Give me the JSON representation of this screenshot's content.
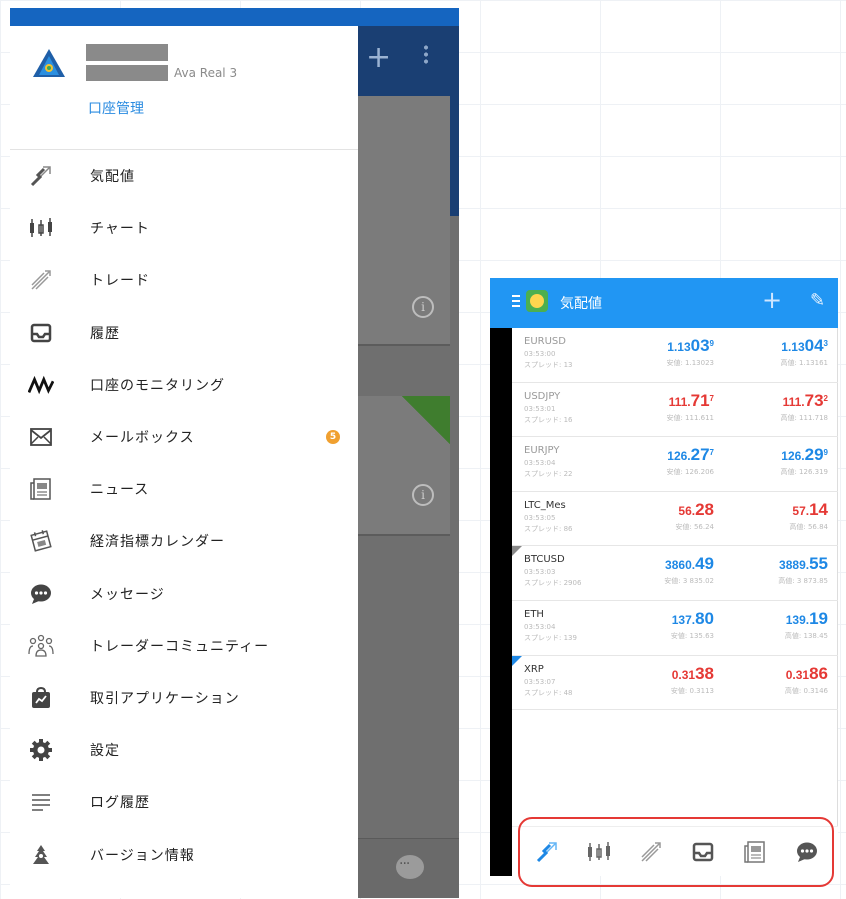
{
  "drawer": {
    "account_name": "Ava Real 3",
    "account_management": "口座管理",
    "items": [
      {
        "label": "気配値",
        "icon": "quotes-icon"
      },
      {
        "label": "チャート",
        "icon": "chart-icon"
      },
      {
        "label": "トレード",
        "icon": "trade-icon"
      },
      {
        "label": "履歴",
        "icon": "history-icon"
      },
      {
        "label": "口座のモニタリング",
        "icon": "monitoring-icon"
      },
      {
        "label": "メールボックス",
        "icon": "mailbox-icon",
        "badge": "5"
      },
      {
        "label": "ニュース",
        "icon": "news-icon"
      },
      {
        "label": "経済指標カレンダー",
        "icon": "calendar-icon"
      },
      {
        "label": "メッセージ",
        "icon": "message-icon"
      },
      {
        "label": "トレーダーコミュニティー",
        "icon": "community-icon"
      },
      {
        "label": "取引アプリケーション",
        "icon": "trading-apps-icon"
      },
      {
        "label": "設定",
        "icon": "settings-icon"
      },
      {
        "label": "ログ履歴",
        "icon": "log-icon"
      },
      {
        "label": "バージョン情報",
        "icon": "about-icon"
      }
    ]
  },
  "quotes_screen": {
    "title": "気配値",
    "rows": [
      {
        "symbol": "EURUSD",
        "time": "03:53:00",
        "spread": "スプレッド: 13",
        "bid_main": "1.13",
        "bid_big": "03",
        "bid_sup": "9",
        "bid_color": "blue",
        "ask_main": "1.13",
        "ask_big": "04",
        "ask_sup": "3",
        "ask_color": "blue",
        "low": "安値: 1.13023",
        "high": "高値: 1.13161"
      },
      {
        "symbol": "USDJPY",
        "time": "03:53:01",
        "spread": "スプレッド: 16",
        "bid_main": "111.",
        "bid_big": "71",
        "bid_sup": "7",
        "bid_color": "red",
        "ask_main": "111.",
        "ask_big": "73",
        "ask_sup": "2",
        "ask_color": "red",
        "low": "安値: 111.611",
        "high": "高値: 111.718"
      },
      {
        "symbol": "EURJPY",
        "time": "03:53:04",
        "spread": "スプレッド: 22",
        "bid_main": "126.",
        "bid_big": "27",
        "bid_sup": "7",
        "bid_color": "blue",
        "ask_main": "126.",
        "ask_big": "29",
        "ask_sup": "9",
        "ask_color": "blue",
        "low": "安値: 126.206",
        "high": "高値: 126.319"
      },
      {
        "symbol": "LTC_Mes",
        "time": "03:53:05",
        "spread": "スプレッド: 86",
        "bid_main": "56.",
        "bid_big": "28",
        "bid_sup": "",
        "bid_color": "red",
        "ask_main": "57.",
        "ask_big": "14",
        "ask_sup": "",
        "ask_color": "red",
        "low": "安値: 56.24",
        "high": "高値: 56.84"
      },
      {
        "symbol": "BTCUSD",
        "time": "03:53:03",
        "spread": "スプレッド: 2906",
        "bid_main": "3860.",
        "bid_big": "49",
        "bid_sup": "",
        "bid_color": "blue",
        "ask_main": "3889.",
        "ask_big": "55",
        "ask_sup": "",
        "ask_color": "blue",
        "low": "安値: 3 835.02",
        "high": "高値: 3 873.85"
      },
      {
        "symbol": "ETH",
        "time": "03:53:04",
        "spread": "スプレッド: 139",
        "bid_main": "137.",
        "bid_big": "80",
        "bid_sup": "",
        "bid_color": "blue",
        "ask_main": "139.",
        "ask_big": "19",
        "ask_sup": "",
        "ask_color": "blue",
        "low": "安値: 135.63",
        "high": "高値: 138.45"
      },
      {
        "symbol": "XRP",
        "time": "03:53:07",
        "spread": "スプレッド: 48",
        "bid_main": "0.31",
        "bid_big": "38",
        "bid_sup": "",
        "bid_color": "red",
        "ask_main": "0.31",
        "ask_big": "86",
        "ask_sup": "",
        "ask_color": "red",
        "low": "安値: 0.3113",
        "high": "高値: 0.3146"
      }
    ],
    "bottom_nav": [
      "quotes-icon",
      "chart-icon",
      "trade-icon",
      "history-icon",
      "news-icon",
      "message-icon"
    ]
  }
}
